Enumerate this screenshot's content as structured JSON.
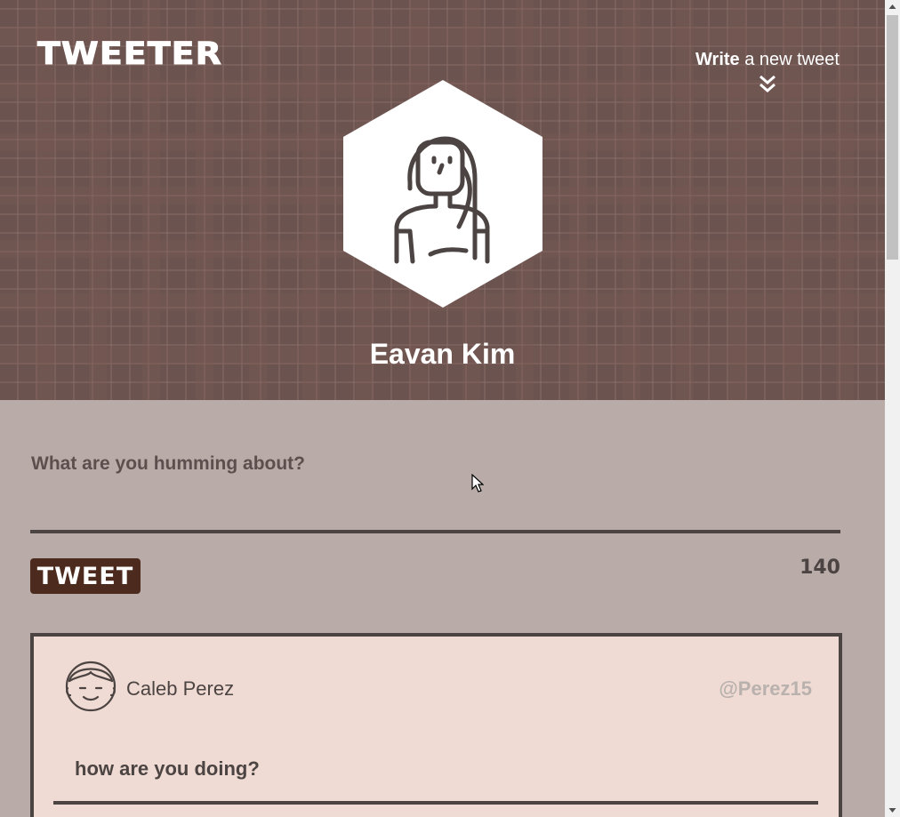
{
  "app": {
    "logo": "TWEETER"
  },
  "nav": {
    "write_bold": "Write",
    "write_rest": " a new tweet",
    "chevron_icon": "double-chevron-down-icon"
  },
  "profile": {
    "name": "Eavan Kim",
    "avatar_icon": "woman-avatar-icon"
  },
  "compose": {
    "placeholder": "What are you humming about?",
    "button_label": "TWEET",
    "char_count": "140"
  },
  "tweets": [
    {
      "author": "Caleb Perez",
      "handle": "@Perez15",
      "text": "how are you doing?",
      "avatar_icon": "man-avatar-icon"
    }
  ],
  "colors": {
    "header_bg": "#6b5450",
    "page_bg": "#b9aba8",
    "button_bg": "#4c2a1e",
    "card_bg": "#efdbd3",
    "text_dark": "#4c4442"
  }
}
